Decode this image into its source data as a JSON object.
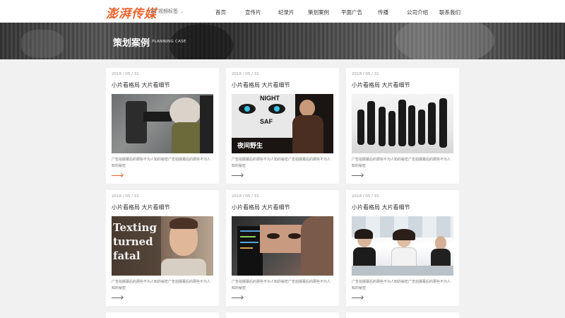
{
  "header": {
    "logo": "澎湃传媒",
    "tag_dropdown": "视频标签",
    "nav": [
      "首页",
      "宣传片",
      "纪录片",
      "策划案例",
      "平面广告",
      "传播",
      "公司介绍",
      "联系我们"
    ]
  },
  "banner": {
    "title": "策划案例",
    "subtitle": "PLANNING CASE"
  },
  "cards": [
    {
      "date": "2018 / 05 / 31",
      "title": "小片看格局 大片看细节",
      "desc": "广告拍摄幕后的那些不为人知的秘密广告拍摄幕后的那些不为人知的秘密"
    },
    {
      "date": "2018 / 05 / 31",
      "title": "小片看格局 大片看细节",
      "desc": "广告拍摄幕后的那些不为人知的秘密广告拍摄幕后的那些不为人知的秘密",
      "thumb_text_top": "NIGHT",
      "thumb_text_mid": "SAF",
      "thumb_text_bottom": "夜间野生"
    },
    {
      "date": "2018 / 05 / 31",
      "title": "小片看格局 大片看细节",
      "desc": "广告拍摄幕后的那些不为人知的秘密广告拍摄幕后的那些不为人知的秘密"
    },
    {
      "date": "2018 / 05 / 31",
      "title": "小片看格局 大片看细节",
      "desc": "广告拍摄幕后的那些不为人知的秘密广告拍摄幕后的那些不为人知的秘密",
      "thumb_text": [
        "Texting",
        "turned",
        "fatal"
      ]
    },
    {
      "date": "2018 / 05 / 31",
      "title": "小片看格局 大片看细节",
      "desc": "广告拍摄幕后的那些不为人知的秘密广告拍摄幕后的那些不为人知的秘密"
    },
    {
      "date": "2018 / 05 / 31",
      "title": "小片看格局 大片看细节",
      "desc": "广告拍摄幕后的那些不为人知的秘密广告拍摄幕后的那些不为人知的秘密"
    }
  ],
  "colors": {
    "accent": "#e8632c",
    "background": "#f1f1f1"
  }
}
